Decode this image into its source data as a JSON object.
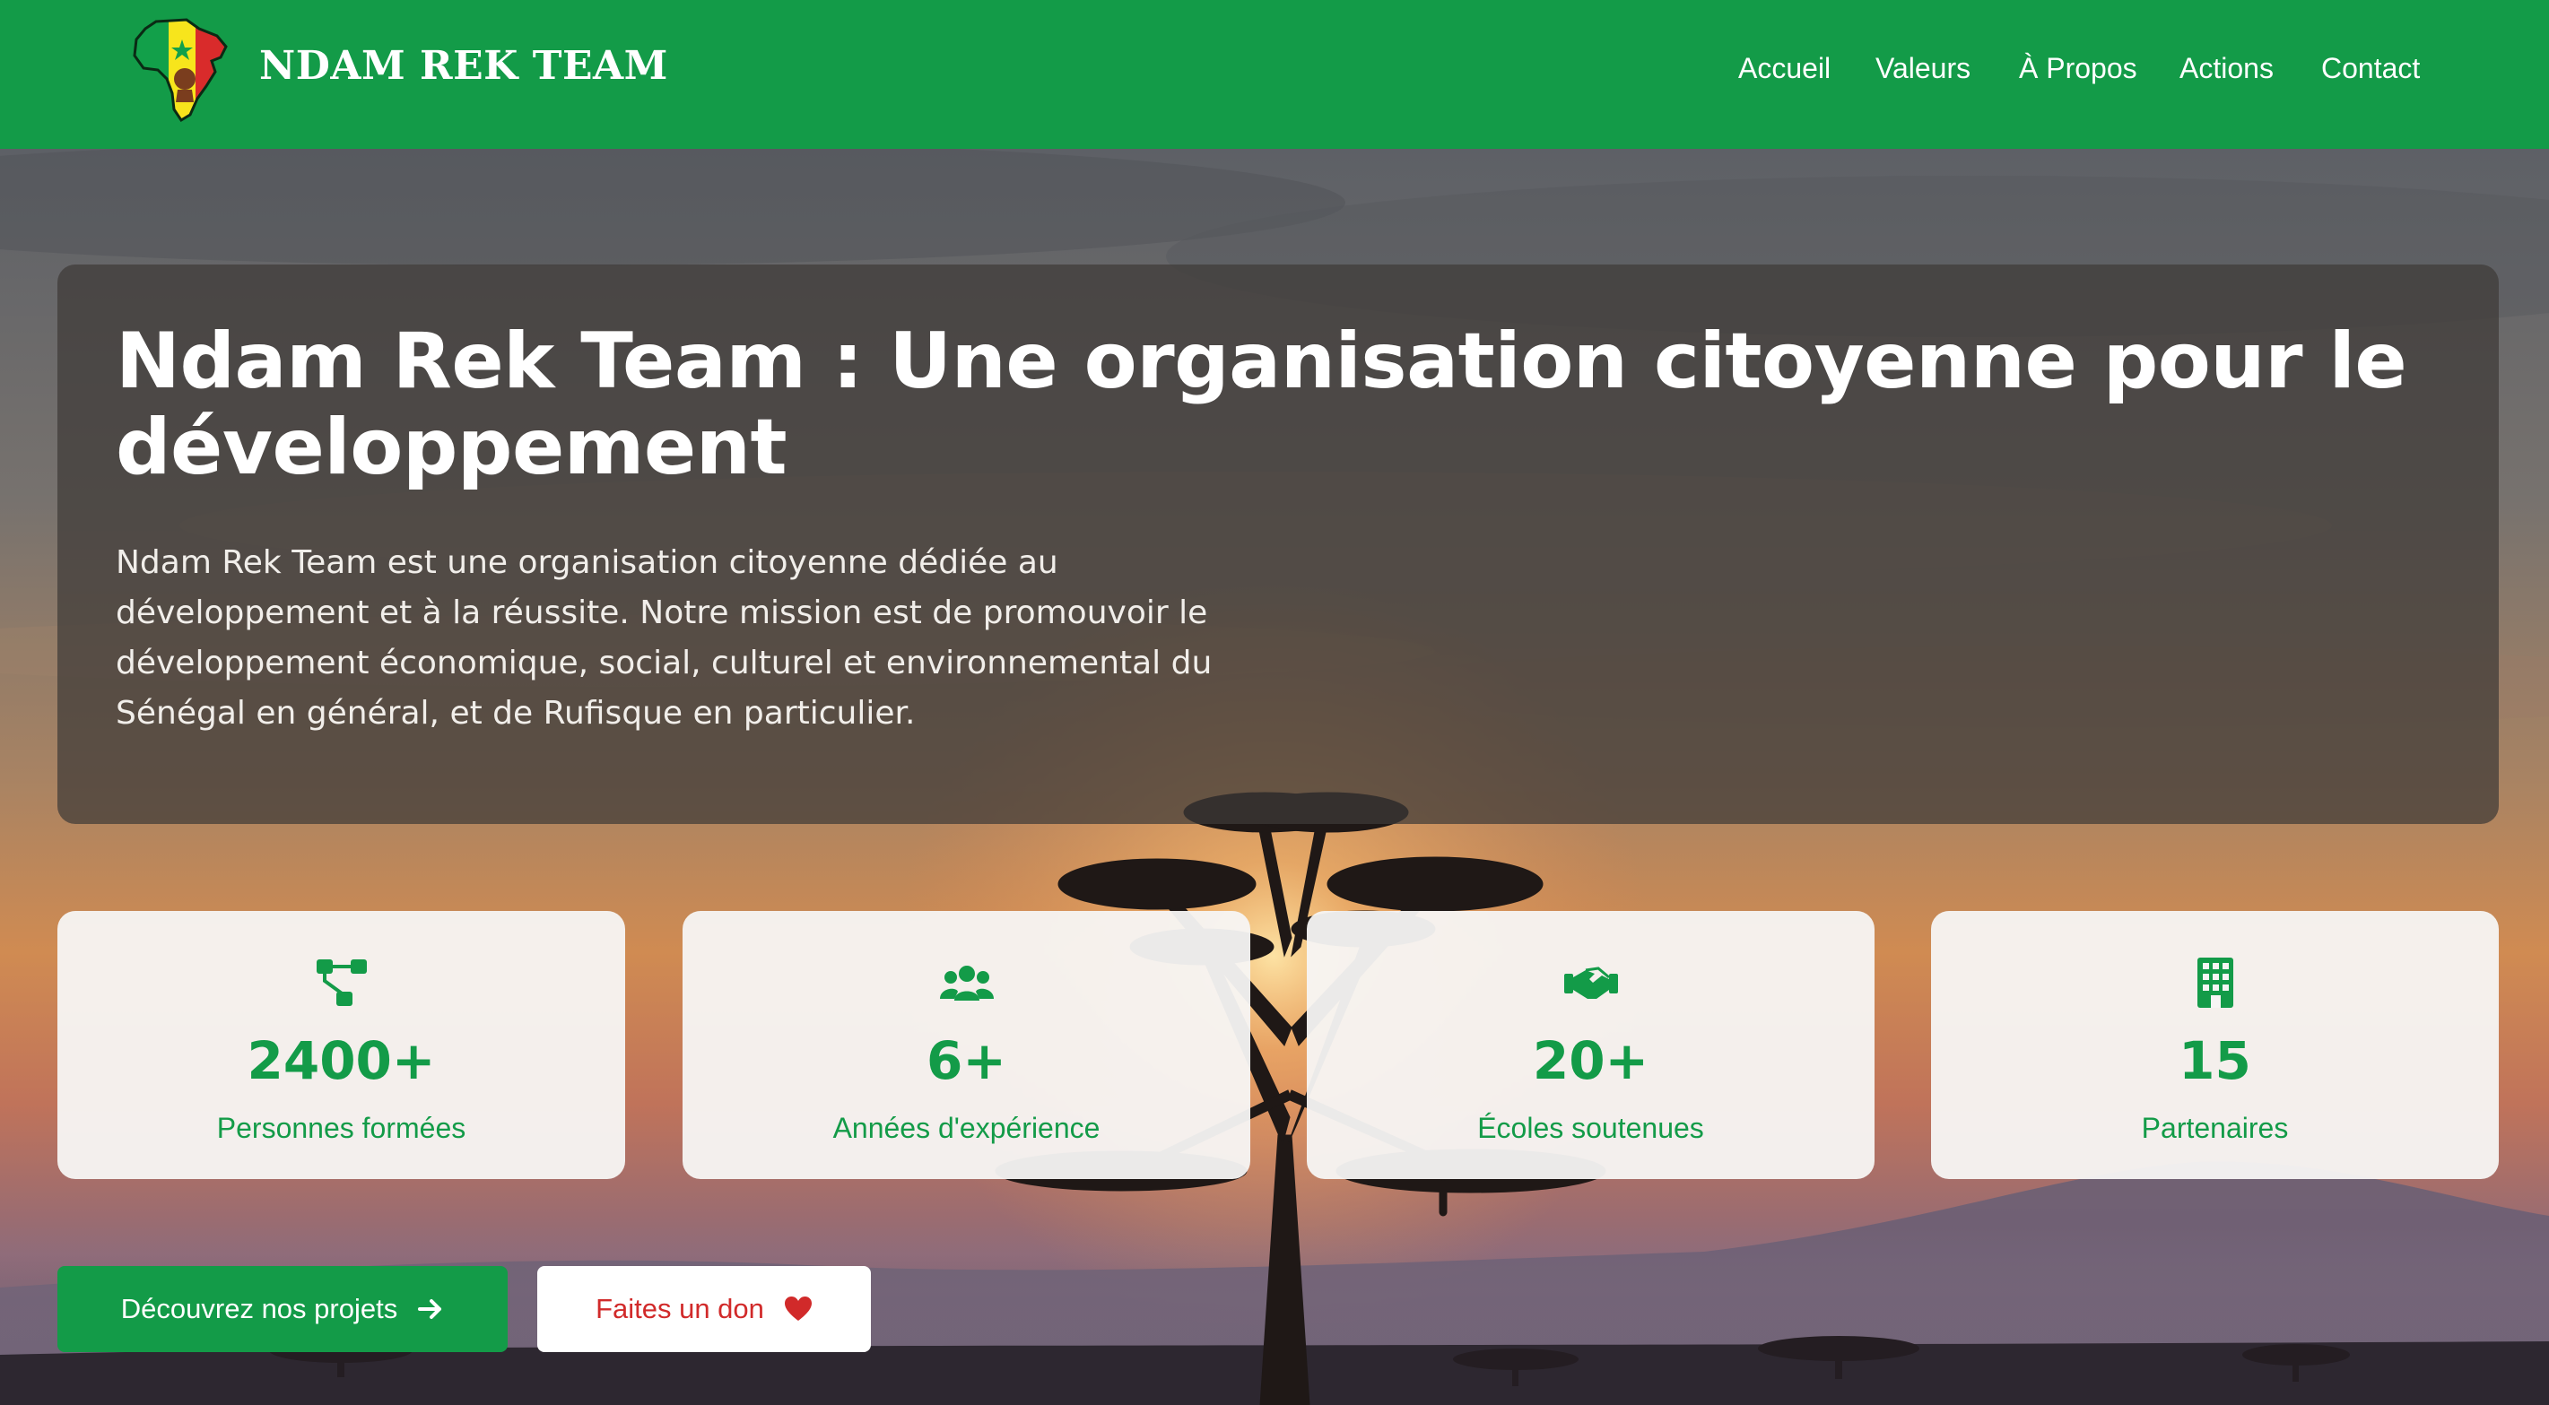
{
  "header": {
    "brand": "NDAM REK TEAM",
    "logo_icon": "africa-map-logo-icon",
    "nav": [
      {
        "label": "Accueil"
      },
      {
        "label": "Valeurs"
      },
      {
        "label": "À Propos"
      },
      {
        "label": "Actions"
      },
      {
        "label": "Contact"
      }
    ]
  },
  "hero": {
    "title": "Ndam Rek Team : Une organisation citoyenne pour le développement",
    "description": "Ndam Rek Team est une organisation citoyenne dédiée au développement et à la réussite. Notre mission est de promouvoir le développement économique, social, culturel et environnemental du Sénégal en général, et de Rufisque en particulier."
  },
  "stats": [
    {
      "icon": "network-icon",
      "value": "2400+",
      "label": "Personnes formées"
    },
    {
      "icon": "users-icon",
      "value": "6+",
      "label": "Années d'expérience"
    },
    {
      "icon": "handshake-icon",
      "value": "20+",
      "label": "Écoles soutenues"
    },
    {
      "icon": "building-icon",
      "value": "15",
      "label": "Partenaires"
    }
  ],
  "actions": {
    "primary_label": "Découvrez nos projets",
    "primary_icon": "arrow-right-icon",
    "secondary_label": "Faites un don",
    "secondary_icon": "heart-icon"
  },
  "colors": {
    "brand_green": "#139b48",
    "donate_red": "#d12a2a",
    "white": "#ffffff"
  }
}
